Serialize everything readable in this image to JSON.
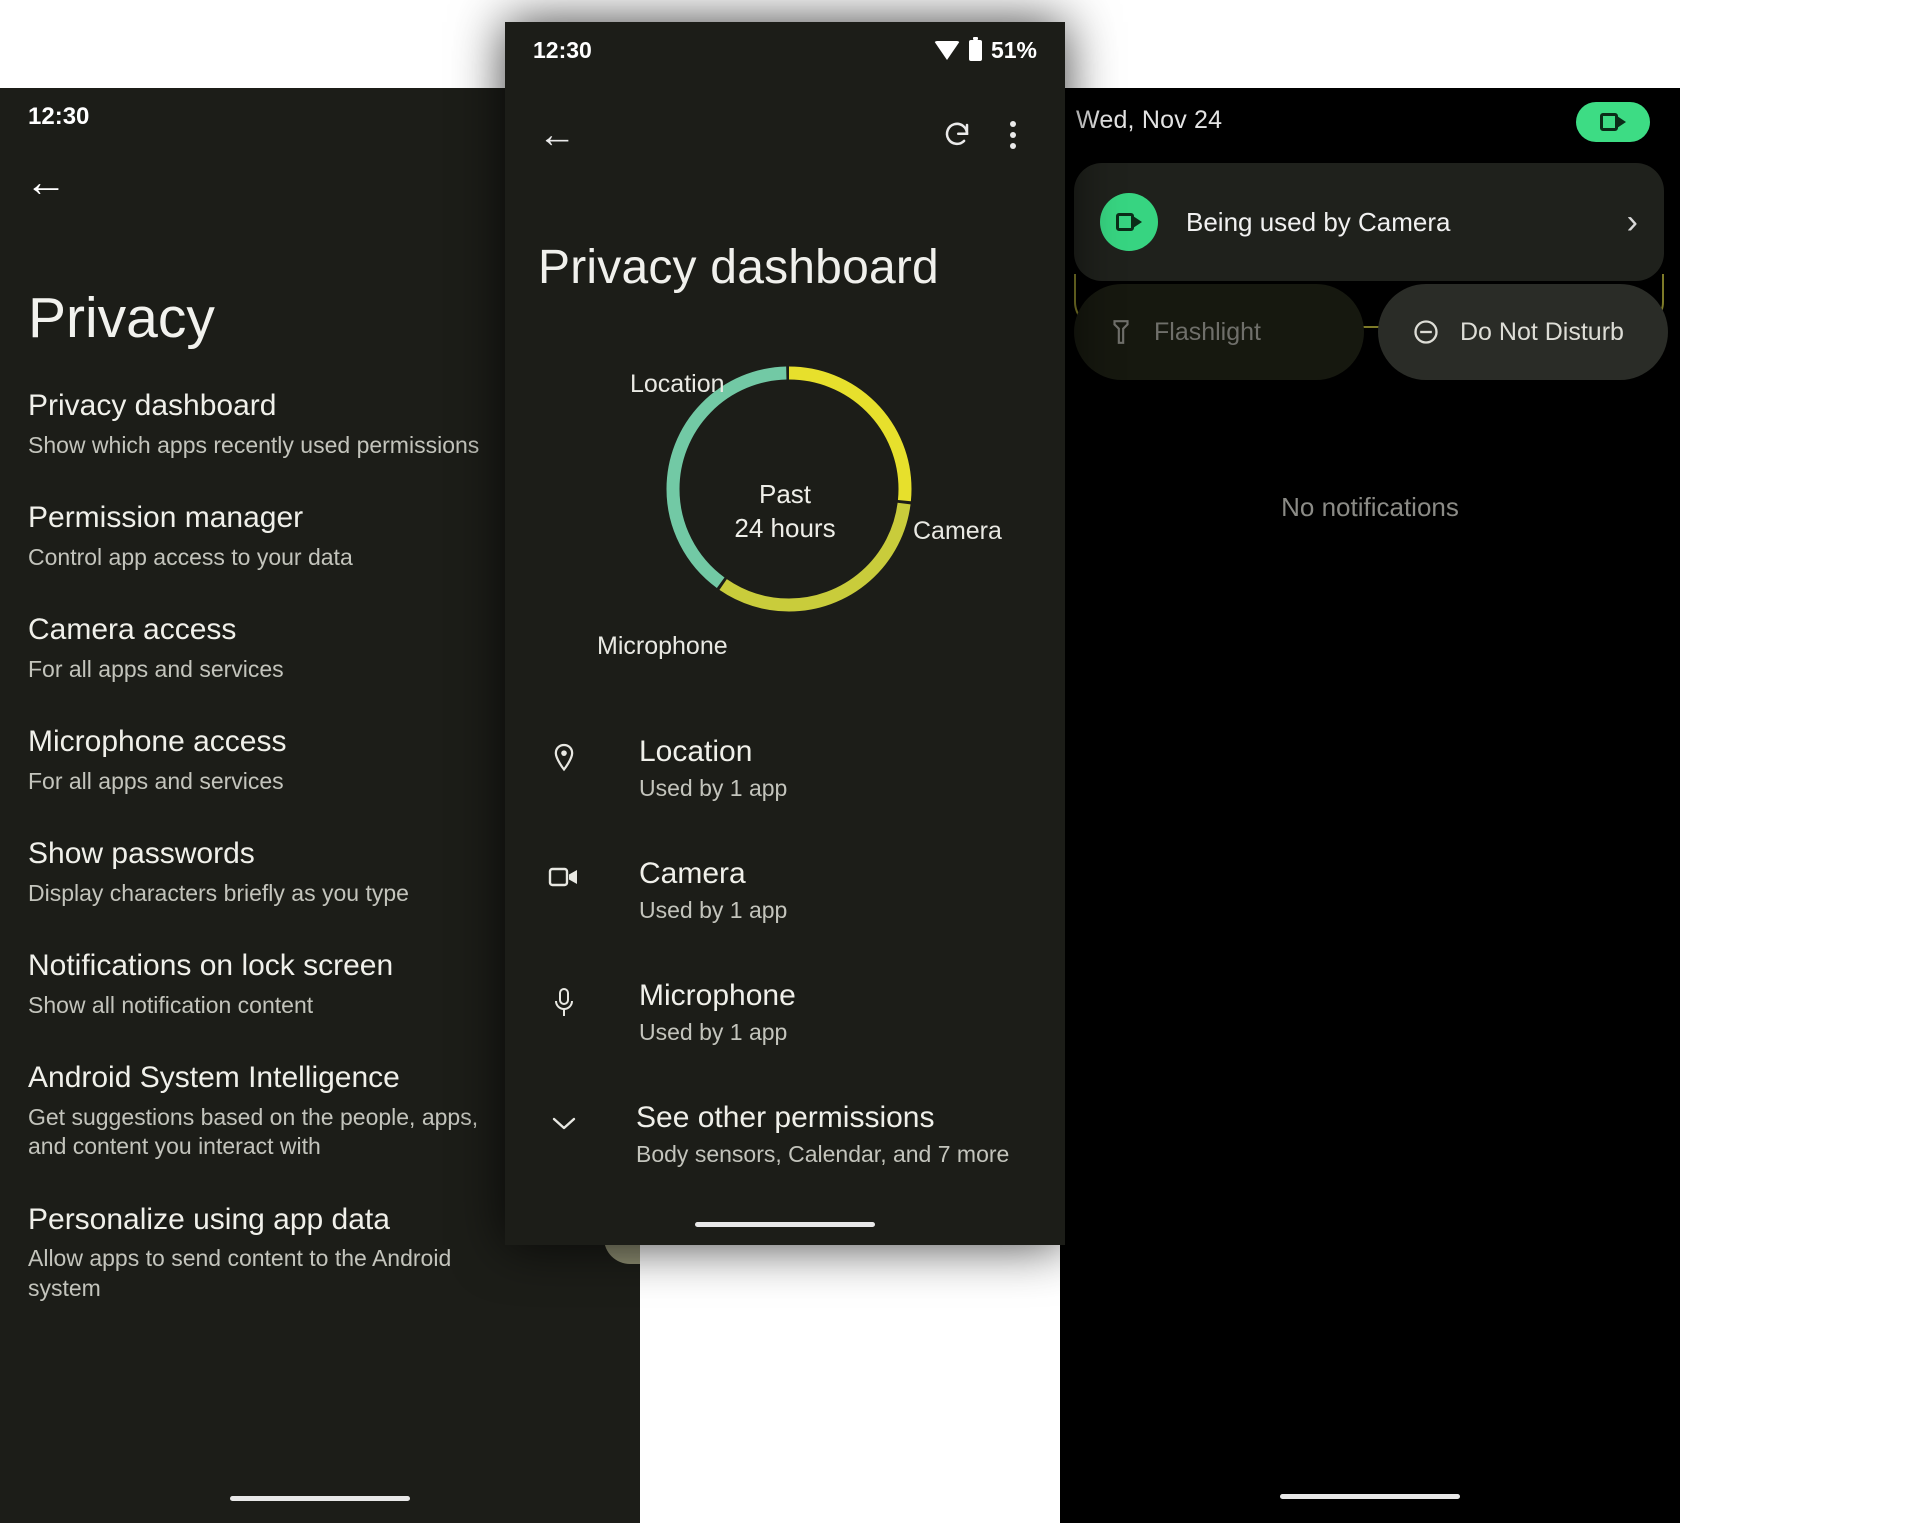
{
  "status_bar": {
    "time": "12:30",
    "battery_percent": "51%",
    "wifi_icon": "wifi-icon",
    "battery_icon": "battery-icon"
  },
  "privacy_screen": {
    "back_icon": "back-arrow-icon",
    "title": "Privacy",
    "items": [
      {
        "title": "Privacy dashboard",
        "subtitle": "Show which apps recently used permissions",
        "toggle": false
      },
      {
        "title": "Permission manager",
        "subtitle": "Control app access to your data",
        "toggle": false
      },
      {
        "title": "Camera access",
        "subtitle": "For all apps and services",
        "toggle": true
      },
      {
        "title": "Microphone access",
        "subtitle": "For all apps and services",
        "toggle": true
      },
      {
        "title": "Show passwords",
        "subtitle": "Display characters briefly as you type",
        "toggle": true
      },
      {
        "title": "Notifications on lock screen",
        "subtitle": "Show all notification content",
        "toggle": false
      },
      {
        "title": "Android System Intelligence",
        "subtitle": "Get suggestions based on the people, apps, and content you interact with",
        "toggle": false
      },
      {
        "title": "Personalize using app data",
        "subtitle": "Allow apps to send content to the Android system",
        "toggle": true
      }
    ]
  },
  "dashboard_screen": {
    "back_icon": "back-arrow-icon",
    "refresh_icon": "refresh-icon",
    "overflow_icon": "more-vertical-icon",
    "title": "Privacy dashboard",
    "center_line1": "Past",
    "center_line2": "24 hours",
    "chart_labels": {
      "location": "Location",
      "camera": "Camera",
      "microphone": "Microphone"
    },
    "items": [
      {
        "icon": "location-pin-icon",
        "title": "Location",
        "subtitle": "Used by 1 app"
      },
      {
        "icon": "camera-icon",
        "title": "Camera",
        "subtitle": "Used by 1 app"
      },
      {
        "icon": "microphone-icon",
        "title": "Microphone",
        "subtitle": "Used by 1 app"
      }
    ],
    "see_other": {
      "icon": "chevron-down-icon",
      "title": "See other permissions",
      "subtitle": "Body sensors, Calendar, and 7 more"
    }
  },
  "shade_screen": {
    "date": "Wed, Nov 24",
    "camera_pill_icon": "camera-active-icon",
    "privacy_chip": {
      "icon": "camera-icon",
      "label": "Being used by Camera",
      "chevron": "chevron-right-icon"
    },
    "tiles": [
      {
        "label": "Flashlight",
        "icon": "flashlight-icon",
        "active": false
      },
      {
        "label": "Do Not Disturb",
        "icon": "do-not-disturb-icon",
        "active": false
      }
    ],
    "empty_text": "No notifications"
  },
  "chart_data": {
    "type": "pie",
    "title": "Privacy dashboard usage — Past 24 hours",
    "categories": [
      "Location",
      "Camera",
      "Microphone"
    ],
    "values": [
      40,
      27,
      33
    ],
    "colors": [
      "#72c9a5",
      "#e7e02c",
      "#c9cc3b"
    ],
    "labels": [
      "Location",
      "Camera",
      "Microphone"
    ],
    "center_text": "Past 24 hours",
    "legend_position": "around-donut",
    "donut": true
  },
  "colors": {
    "background": "#1c1d18",
    "shade_background": "#000000",
    "accent_green": "#3ddc84",
    "toggle_track": "#8e8e72",
    "toggle_thumb": "#dbe06a",
    "location_arc": "#72c9a5",
    "camera_arc": "#e7e02c",
    "microphone_arc": "#c9cc3b",
    "text_primary": "#f0f0ea",
    "text_secondary": "#c3c4bc"
  }
}
